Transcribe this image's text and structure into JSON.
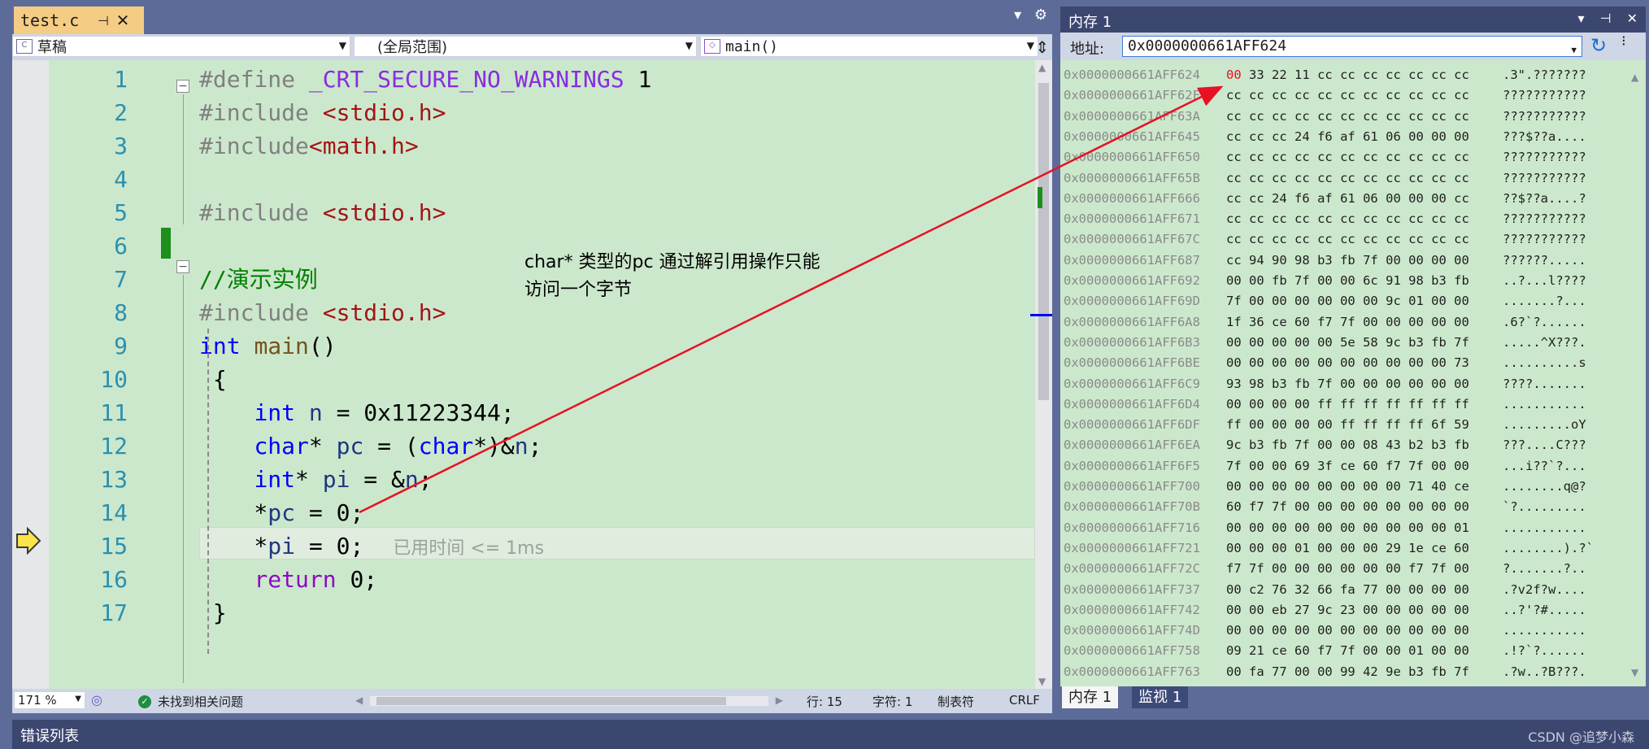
{
  "editor": {
    "tab": {
      "name": "test.c",
      "pin": "⊣",
      "close": "✕"
    },
    "tab_actions": {
      "dropdown": "▾",
      "settings": "⚙"
    },
    "nav": {
      "project": "草稿",
      "scope": "(全局范围)",
      "member": "main()"
    },
    "current_line": 15,
    "lines": [
      {
        "n": "1",
        "code": [
          [
            "pp",
            "#define "
          ],
          [
            "mac",
            "_CRT_SECURE_NO_WARNINGS"
          ],
          [
            "",
            " 1"
          ]
        ]
      },
      {
        "n": "2",
        "code": [
          [
            "pp",
            "#include "
          ],
          [
            "str",
            "<stdio.h>"
          ]
        ]
      },
      {
        "n": "3",
        "code": [
          [
            "pp",
            "#include"
          ],
          [
            "str",
            "<math.h>"
          ]
        ]
      },
      {
        "n": "4",
        "code": []
      },
      {
        "n": "5",
        "code": [
          [
            "pp",
            "#include "
          ],
          [
            "str",
            "<stdio.h>"
          ]
        ]
      },
      {
        "n": "6",
        "code": []
      },
      {
        "n": "7",
        "code": [
          [
            "cmt",
            "//演示实例"
          ]
        ]
      },
      {
        "n": "8",
        "code": [
          [
            "pp",
            "#include "
          ],
          [
            "str",
            "<stdio.h>"
          ]
        ]
      },
      {
        "n": "9",
        "code": [
          [
            "kw",
            "int"
          ],
          [
            "",
            " "
          ],
          [
            "fn",
            "main"
          ],
          [
            "",
            "()"
          ]
        ]
      },
      {
        "n": "10",
        "code": [
          [
            "",
            " {"
          ]
        ]
      },
      {
        "n": "11",
        "code": [
          [
            "",
            "    "
          ],
          [
            "kw",
            "int"
          ],
          [
            "",
            " "
          ],
          [
            "var",
            "n"
          ],
          [
            "",
            " = 0x11223344;"
          ]
        ]
      },
      {
        "n": "12",
        "code": [
          [
            "",
            "    "
          ],
          [
            "kw",
            "char"
          ],
          [
            "",
            "* "
          ],
          [
            "var",
            "pc"
          ],
          [
            "",
            " = ("
          ],
          [
            "kw",
            "char"
          ],
          [
            "",
            "*)&"
          ],
          [
            "var",
            "n"
          ],
          [
            "",
            ";"
          ]
        ]
      },
      {
        "n": "13",
        "code": [
          [
            "",
            "    "
          ],
          [
            "kw",
            "int"
          ],
          [
            "",
            "* "
          ],
          [
            "var",
            "pi"
          ],
          [
            "",
            " = &"
          ],
          [
            "var",
            "n"
          ],
          [
            "",
            ";"
          ]
        ]
      },
      {
        "n": "14",
        "code": [
          [
            "",
            "    *"
          ],
          [
            "var",
            "pc"
          ],
          [
            "",
            " = 0;"
          ]
        ]
      },
      {
        "n": "15",
        "code": [
          [
            "",
            "    *"
          ],
          [
            "var",
            "pi"
          ],
          [
            "",
            " = 0;"
          ]
        ]
      },
      {
        "n": "16",
        "code": [
          [
            "",
            "    "
          ],
          [
            "ctl",
            "return"
          ],
          [
            "",
            " 0;"
          ]
        ]
      },
      {
        "n": "17",
        "code": [
          [
            "",
            " }"
          ]
        ]
      }
    ],
    "time_hint": "已用时间 <= 1ms",
    "annotation": [
      "char* 类型的pc 通过解引用操作只能",
      "访问一个字节"
    ]
  },
  "status": {
    "zoom": "171 %",
    "issues": "未找到相关问题",
    "line": "行: 15",
    "char": "字符: 1",
    "mode": "制表符",
    "eol": "CRLF"
  },
  "memory": {
    "title": "内存 1",
    "title_controls": {
      "dropdown": "▾",
      "pin": "⊣",
      "close": "✕"
    },
    "address_label": "地址:",
    "address_value": "0x0000000661AFF624",
    "highlight": {
      "row": 0,
      "byte": 0,
      "color": "#e81123"
    },
    "rows": [
      {
        "addr": "0x0000000661AFF624",
        "bytes": [
          "00",
          "33",
          "22",
          "11",
          "cc",
          "cc",
          "cc",
          "cc",
          "cc",
          "cc",
          "cc"
        ],
        "ascii": ".3\".???????"
      },
      {
        "addr": "0x0000000661AFF62F",
        "bytes": [
          "cc",
          "cc",
          "cc",
          "cc",
          "cc",
          "cc",
          "cc",
          "cc",
          "cc",
          "cc",
          "cc"
        ],
        "ascii": "???????????"
      },
      {
        "addr": "0x0000000661AFF63A",
        "bytes": [
          "cc",
          "cc",
          "cc",
          "cc",
          "cc",
          "cc",
          "cc",
          "cc",
          "cc",
          "cc",
          "cc"
        ],
        "ascii": "???????????"
      },
      {
        "addr": "0x0000000661AFF645",
        "bytes": [
          "cc",
          "cc",
          "cc",
          "24",
          "f6",
          "af",
          "61",
          "06",
          "00",
          "00",
          "00"
        ],
        "ascii": "???$??a...."
      },
      {
        "addr": "0x0000000661AFF650",
        "bytes": [
          "cc",
          "cc",
          "cc",
          "cc",
          "cc",
          "cc",
          "cc",
          "cc",
          "cc",
          "cc",
          "cc"
        ],
        "ascii": "???????????"
      },
      {
        "addr": "0x0000000661AFF65B",
        "bytes": [
          "cc",
          "cc",
          "cc",
          "cc",
          "cc",
          "cc",
          "cc",
          "cc",
          "cc",
          "cc",
          "cc"
        ],
        "ascii": "???????????"
      },
      {
        "addr": "0x0000000661AFF666",
        "bytes": [
          "cc",
          "cc",
          "24",
          "f6",
          "af",
          "61",
          "06",
          "00",
          "00",
          "00",
          "cc"
        ],
        "ascii": "??$??a....?"
      },
      {
        "addr": "0x0000000661AFF671",
        "bytes": [
          "cc",
          "cc",
          "cc",
          "cc",
          "cc",
          "cc",
          "cc",
          "cc",
          "cc",
          "cc",
          "cc"
        ],
        "ascii": "???????????"
      },
      {
        "addr": "0x0000000661AFF67C",
        "bytes": [
          "cc",
          "cc",
          "cc",
          "cc",
          "cc",
          "cc",
          "cc",
          "cc",
          "cc",
          "cc",
          "cc"
        ],
        "ascii": "???????????"
      },
      {
        "addr": "0x0000000661AFF687",
        "bytes": [
          "cc",
          "94",
          "90",
          "98",
          "b3",
          "fb",
          "7f",
          "00",
          "00",
          "00",
          "00"
        ],
        "ascii": "??????....."
      },
      {
        "addr": "0x0000000661AFF692",
        "bytes": [
          "00",
          "00",
          "fb",
          "7f",
          "00",
          "00",
          "6c",
          "91",
          "98",
          "b3",
          "fb"
        ],
        "ascii": "..?...l????"
      },
      {
        "addr": "0x0000000661AFF69D",
        "bytes": [
          "7f",
          "00",
          "00",
          "00",
          "00",
          "00",
          "00",
          "9c",
          "01",
          "00",
          "00"
        ],
        "ascii": ".......?..."
      },
      {
        "addr": "0x0000000661AFF6A8",
        "bytes": [
          "1f",
          "36",
          "ce",
          "60",
          "f7",
          "7f",
          "00",
          "00",
          "00",
          "00",
          "00"
        ],
        "ascii": ".6?`?......"
      },
      {
        "addr": "0x0000000661AFF6B3",
        "bytes": [
          "00",
          "00",
          "00",
          "00",
          "00",
          "5e",
          "58",
          "9c",
          "b3",
          "fb",
          "7f"
        ],
        "ascii": ".....^X???."
      },
      {
        "addr": "0x0000000661AFF6BE",
        "bytes": [
          "00",
          "00",
          "00",
          "00",
          "00",
          "00",
          "00",
          "00",
          "00",
          "00",
          "73"
        ],
        "ascii": "..........s"
      },
      {
        "addr": "0x0000000661AFF6C9",
        "bytes": [
          "93",
          "98",
          "b3",
          "fb",
          "7f",
          "00",
          "00",
          "00",
          "00",
          "00",
          "00"
        ],
        "ascii": "????......."
      },
      {
        "addr": "0x0000000661AFF6D4",
        "bytes": [
          "00",
          "00",
          "00",
          "00",
          "ff",
          "ff",
          "ff",
          "ff",
          "ff",
          "ff",
          "ff"
        ],
        "ascii": "..........."
      },
      {
        "addr": "0x0000000661AFF6DF",
        "bytes": [
          "ff",
          "00",
          "00",
          "00",
          "00",
          "ff",
          "ff",
          "ff",
          "ff",
          "6f",
          "59"
        ],
        "ascii": ".........oY"
      },
      {
        "addr": "0x0000000661AFF6EA",
        "bytes": [
          "9c",
          "b3",
          "fb",
          "7f",
          "00",
          "00",
          "08",
          "43",
          "b2",
          "b3",
          "fb"
        ],
        "ascii": "???....C???"
      },
      {
        "addr": "0x0000000661AFF6F5",
        "bytes": [
          "7f",
          "00",
          "00",
          "69",
          "3f",
          "ce",
          "60",
          "f7",
          "7f",
          "00",
          "00"
        ],
        "ascii": "...i??`?..."
      },
      {
        "addr": "0x0000000661AFF700",
        "bytes": [
          "00",
          "00",
          "00",
          "00",
          "00",
          "00",
          "00",
          "00",
          "71",
          "40",
          "ce"
        ],
        "ascii": "........q@?"
      },
      {
        "addr": "0x0000000661AFF70B",
        "bytes": [
          "60",
          "f7",
          "7f",
          "00",
          "00",
          "00",
          "00",
          "00",
          "00",
          "00",
          "00"
        ],
        "ascii": "`?........."
      },
      {
        "addr": "0x0000000661AFF716",
        "bytes": [
          "00",
          "00",
          "00",
          "00",
          "00",
          "00",
          "00",
          "00",
          "00",
          "00",
          "01"
        ],
        "ascii": "..........."
      },
      {
        "addr": "0x0000000661AFF721",
        "bytes": [
          "00",
          "00",
          "00",
          "01",
          "00",
          "00",
          "00",
          "29",
          "1e",
          "ce",
          "60"
        ],
        "ascii": "........).?`"
      },
      {
        "addr": "0x0000000661AFF72C",
        "bytes": [
          "f7",
          "7f",
          "00",
          "00",
          "00",
          "00",
          "00",
          "00",
          "f7",
          "7f",
          "00"
        ],
        "ascii": "?.......?.."
      },
      {
        "addr": "0x0000000661AFF737",
        "bytes": [
          "00",
          "c2",
          "76",
          "32",
          "66",
          "fa",
          "77",
          "00",
          "00",
          "00",
          "00"
        ],
        "ascii": ".?v2f?w...."
      },
      {
        "addr": "0x0000000661AFF742",
        "bytes": [
          "00",
          "00",
          "eb",
          "27",
          "9c",
          "23",
          "00",
          "00",
          "00",
          "00",
          "00"
        ],
        "ascii": "..?'?#....."
      },
      {
        "addr": "0x0000000661AFF74D",
        "bytes": [
          "00",
          "00",
          "00",
          "00",
          "00",
          "00",
          "00",
          "00",
          "00",
          "00",
          "00"
        ],
        "ascii": "..........."
      },
      {
        "addr": "0x0000000661AFF758",
        "bytes": [
          "09",
          "21",
          "ce",
          "60",
          "f7",
          "7f",
          "00",
          "00",
          "01",
          "00",
          "00"
        ],
        "ascii": ".!?`?......"
      },
      {
        "addr": "0x0000000661AFF763",
        "bytes": [
          "00",
          "fa",
          "77",
          "00",
          "00",
          "99",
          "42",
          "9e",
          "b3",
          "fb",
          "7f"
        ],
        "ascii": ".?w..?B???."
      }
    ],
    "tabs": [
      "内存 1",
      "监视 1"
    ]
  },
  "bottom": {
    "label": "错误列表",
    "watermark": "CSDN @追梦小森"
  },
  "colors": {
    "accent": "#e81123",
    "change_bar": "#1d8f1d",
    "code_bg": "#cce8cc",
    "chrome": "#5d6b99"
  }
}
